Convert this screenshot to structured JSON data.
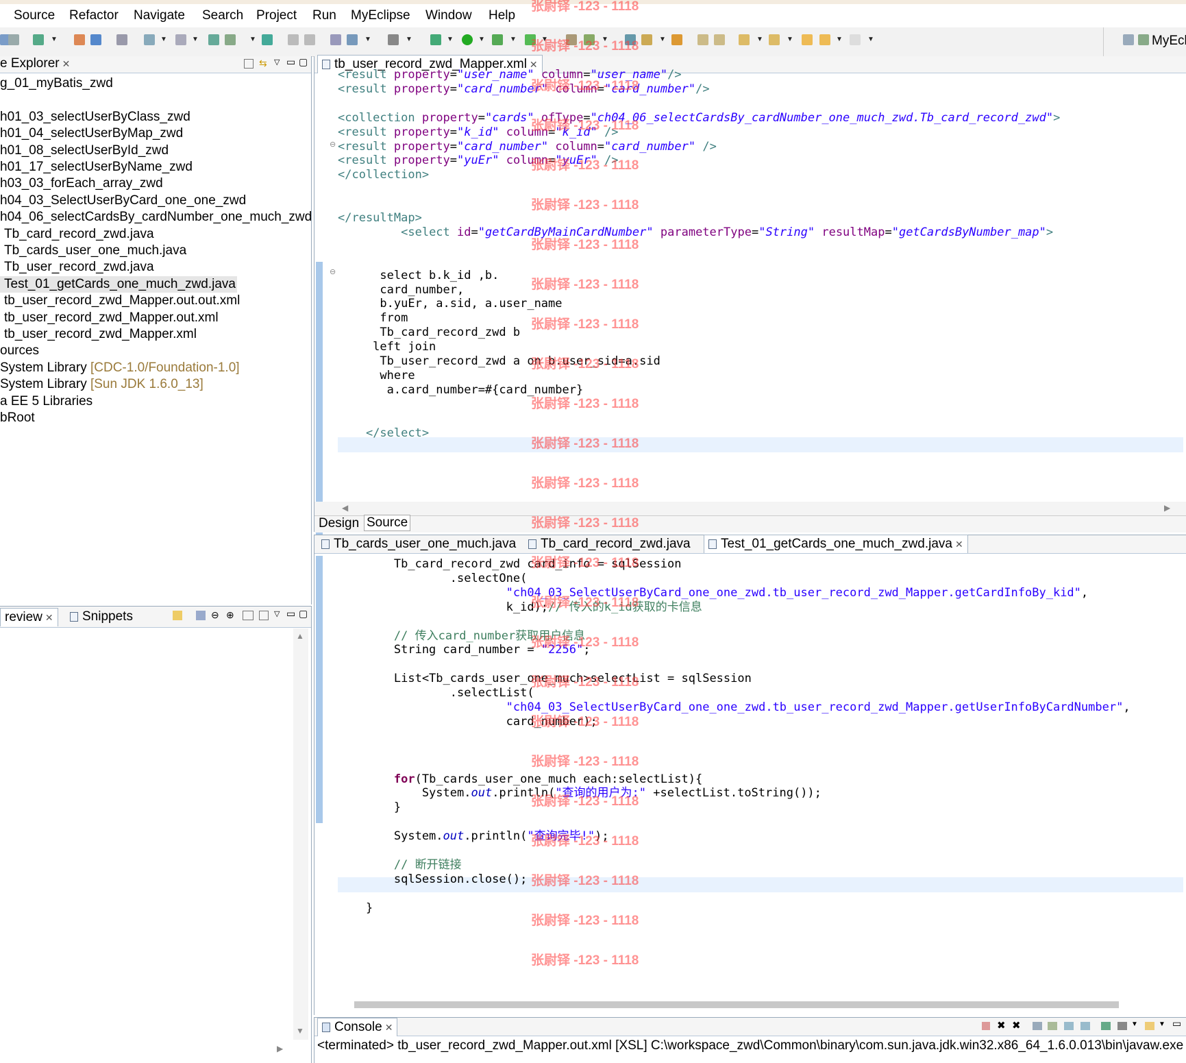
{
  "menu": [
    "Source",
    "Refactor",
    "Navigate",
    "Search",
    "Project",
    "Run",
    "MyEclipse",
    "Window",
    "Help"
  ],
  "perspective_label": "MyEcl",
  "explorer": {
    "tab_label": "e Explorer",
    "items": [
      {
        "text": "g_01_myBatis_zwd",
        "extra": ""
      },
      {
        "text": "",
        "extra": ""
      },
      {
        "text": "h01_03_selectUserByClass_zwd",
        "extra": ""
      },
      {
        "text": "h01_04_selectUserByMap_zwd",
        "extra": ""
      },
      {
        "text": "h01_08_selectUserById_zwd",
        "extra": ""
      },
      {
        "text": "h01_17_selectUserByName_zwd",
        "extra": ""
      },
      {
        "text": "h03_03_forEach_array_zwd",
        "extra": ""
      },
      {
        "text": "h04_03_SelectUserByCard_one_one_zwd",
        "extra": ""
      },
      {
        "text": "h04_06_selectCardsBy_cardNumber_one_much_zwd",
        "extra": ""
      },
      {
        "text": "Tb_card_record_zwd.java",
        "extra": ""
      },
      {
        "text": "Tb_cards_user_one_much.java",
        "extra": ""
      },
      {
        "text": "Tb_user_record_zwd.java",
        "extra": ""
      },
      {
        "text": "Test_01_getCards_one_much_zwd.java",
        "extra": ""
      },
      {
        "text": "tb_user_record_zwd_Mapper.out.out.xml",
        "extra": ""
      },
      {
        "text": "tb_user_record_zwd_Mapper.out.xml",
        "extra": ""
      },
      {
        "text": "tb_user_record_zwd_Mapper.xml",
        "extra": ""
      },
      {
        "text": "ources",
        "extra": ""
      },
      {
        "text": "System Library ",
        "extra": "[CDC-1.0/Foundation-1.0]"
      },
      {
        "text": "System Library ",
        "extra": "[Sun JDK 1.6.0_13]"
      },
      {
        "text": "a EE 5 Libraries",
        "extra": ""
      },
      {
        "text": "bRoot",
        "extra": ""
      }
    ]
  },
  "bottom_left": {
    "tab1": "review",
    "tab2": "Snippets"
  },
  "xml_editor": {
    "tab_label": "tb_user_record_zwd_Mapper.xml",
    "bottom_tabs": [
      "Design",
      "Source"
    ],
    "lines": [
      "<result property=\"user_name\" column=\"user_name\"/>",
      "<result property=\"card_number\" column=\"card_number\"/>",
      "",
      "<collection property=\"cards\" ofType=\"ch04_06_selectCardsBy_cardNumber_one_much_zwd.Tb_card_record_zwd\">",
      "<result property=\"k_id\" column=\"k_id\" />",
      "<result property=\"card_number\" column=\"card_number\" />",
      "<result property=\"yuEr\" column=\"yuEr\" />",
      "</collection>",
      "",
      "",
      "</resultMap>",
      "         <select id=\"getCardByMainCardNumber\" parameterType=\"String\" resultMap=\"getCardsByNumber_map\">",
      "",
      "",
      "      select b.k_id ,b.",
      "      card_number,",
      "      b.yuEr, a.sid, a.user_name",
      "      from",
      "      Tb_card_record_zwd b",
      "     left join",
      "      Tb_user_record_zwd a on b.user_sid=a.sid",
      "      where",
      "       a.card_number=#{card_number}",
      "",
      "",
      "    </select>"
    ]
  },
  "java_editor": {
    "tabs": [
      "Tb_cards_user_one_much.java",
      "Tb_card_record_zwd.java",
      "Test_01_getCards_one_much_zwd.java"
    ],
    "lines": [
      "        Tb_card_record_zwd card_info = sqlSession",
      "                .selectOne(",
      "                        \"ch04_03_SelectUserByCard_one_one_zwd.tb_user_record_zwd_Mapper.getCardInfoBy_kid\",",
      "                        k_id);// 传入的k_id获取的卡信息",
      "",
      "        // 传入card_number获取用户信息",
      "        String card_number = \"2256\";",
      "",
      "        List<Tb_cards_user_one_much>selectList = sqlSession",
      "                .selectList(",
      "                        \"ch04_03_SelectUserByCard_one_one_zwd.tb_user_record_zwd_Mapper.getUserInfoByCardNumber\",",
      "                        card_number);",
      "",
      "",
      "",
      "        for(Tb_cards_user_one_much each:selectList){",
      "            System.out.println(\"查询的用户为:\" +selectList.toString());",
      "        }",
      "",
      "        System.out.println(\"查询完毕!\");",
      "",
      "        // 断开链接",
      "        sqlSession.close();",
      "",
      "    }"
    ]
  },
  "console": {
    "tab_label": "Console",
    "text": "<terminated> tb_user_record_zwd_Mapper.out.xml [XSL] C:\\workspace_zwd\\Common\\binary\\com.sun.java.jdk.win32.x86_64_1.6.0.013\\bin\\javaw.exe"
  },
  "watermark": "张尉铎 -123 - 1118"
}
